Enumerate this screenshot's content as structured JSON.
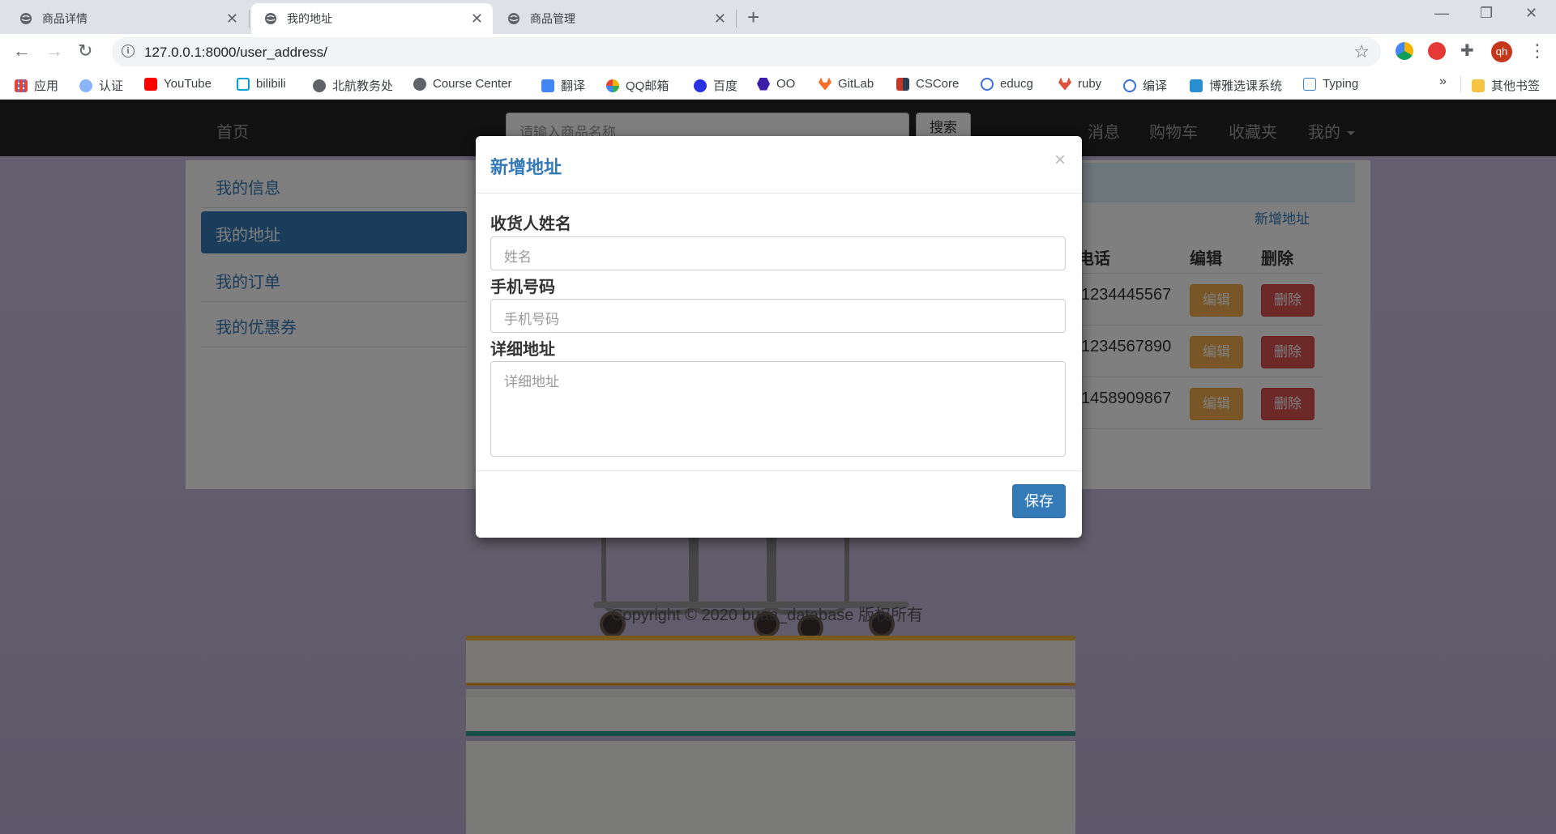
{
  "browser": {
    "tabs": [
      {
        "title": "商品详情"
      },
      {
        "title": "我的地址"
      },
      {
        "title": "商品管理"
      }
    ],
    "url": "127.0.0.1:8000/user_address/",
    "profile_initials": "qh",
    "bookmarks": [
      {
        "label": "应用",
        "icon": "apps-grid-icon",
        "color": "#1a73e8"
      },
      {
        "label": "认证",
        "icon": "auth-icon",
        "color": "#5f6368"
      },
      {
        "label": "YouTube",
        "icon": "youtube-icon",
        "color": "#ff0000"
      },
      {
        "label": "bilibili",
        "icon": "bilibili-icon",
        "color": "#00a1d6"
      },
      {
        "label": "北航教务处",
        "icon": "globe-icon",
        "color": "#5f6368"
      },
      {
        "label": "Course Center",
        "icon": "globe-icon",
        "color": "#5f6368"
      },
      {
        "label": "翻译",
        "icon": "translate-icon",
        "color": "#4285f4"
      },
      {
        "label": "QQ邮箱",
        "icon": "qqmail-icon",
        "color": "#f4b400"
      },
      {
        "label": "百度",
        "icon": "baidu-icon",
        "color": "#2932e1"
      },
      {
        "label": "OO",
        "icon": "hexagon-icon",
        "color": "#3c1fa8"
      },
      {
        "label": "GitLab",
        "icon": "gitlab-icon",
        "color": "#fc6d26"
      },
      {
        "label": "CSCore",
        "icon": "cscore-icon",
        "color": "#c0392b"
      },
      {
        "label": "educg",
        "icon": "educg-icon",
        "color": "#3b6fd6"
      },
      {
        "label": "ruby",
        "icon": "ruby-icon",
        "color": "#e0503b"
      },
      {
        "label": "编译",
        "icon": "educg-icon",
        "color": "#3b6fd6"
      },
      {
        "label": "博雅选课系统",
        "icon": "book-icon",
        "color": "#2a8fd0"
      },
      {
        "label": "Typing",
        "icon": "typing-icon",
        "color": "#3b7dd8"
      }
    ],
    "bookmarks_more": "»",
    "other_bookmarks": "其他书签"
  },
  "site": {
    "nav": {
      "home": "首页",
      "search_placeholder": "请输入商品名称",
      "search_button": "搜索",
      "links": [
        "消息",
        "购物车",
        "收藏夹",
        "我的"
      ]
    },
    "sidebar": [
      {
        "label": "我的信息"
      },
      {
        "label": "我的地址"
      },
      {
        "label": "我的订单"
      },
      {
        "label": "我的优惠券"
      }
    ],
    "address_table": {
      "add_link": "新增地址",
      "headers": {
        "phone": "电话",
        "edit": "编辑",
        "delete": "删除"
      },
      "rows": [
        {
          "phone": "1234445567",
          "edit": "编辑",
          "delete": "删除"
        },
        {
          "phone": "1234567890",
          "edit": "编辑",
          "delete": "删除"
        },
        {
          "phone": "1458909867",
          "edit": "编辑",
          "delete": "删除"
        }
      ]
    },
    "footer": "Copyright © 2020  buaa_database 版权所有"
  },
  "modal": {
    "title": "新增地址",
    "close": "×",
    "fields": [
      {
        "label": "收货人姓名",
        "placeholder": "姓名"
      },
      {
        "label": "手机号码",
        "placeholder": "手机号码"
      },
      {
        "label": "详细地址",
        "placeholder": "详细地址"
      }
    ],
    "save": "保存"
  },
  "colors": {
    "primary": "#337ab7",
    "warning": "#f0ad4e",
    "danger": "#d9534f",
    "navbar": "#222222"
  }
}
